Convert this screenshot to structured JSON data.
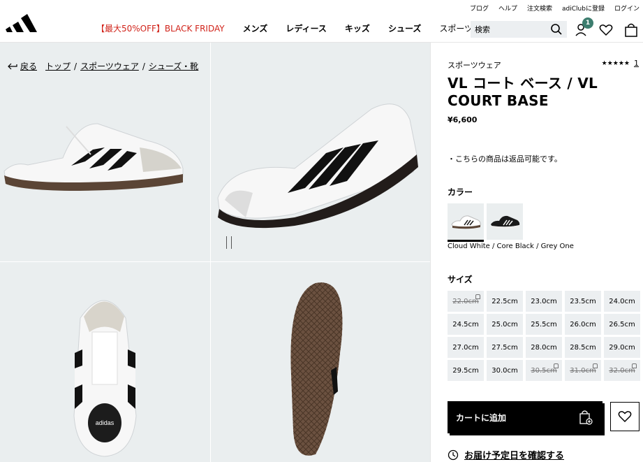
{
  "util_links": [
    "ブログ",
    "ヘルプ",
    "注文検索",
    "adiClubに登録",
    "ログイン"
  ],
  "nav": {
    "promo": "【最大50%OFF】BLACK FRIDAY",
    "items": [
      "メンズ",
      "レディース",
      "キッズ",
      "シューズ",
      "スポーツ"
    ]
  },
  "search": {
    "placeholder": "検索"
  },
  "cart_badge": "1",
  "breadcrumb": {
    "back": "戻る",
    "items": [
      "トップ",
      "スポーツウェア",
      "シューズ・靴"
    ]
  },
  "product": {
    "category": "スポーツウェア",
    "rating_stars": "★★★★★",
    "review_count": "1",
    "title": "VL コート ベース / VL COURT BASE",
    "price": "¥6,600",
    "return_notice": "・こちらの商品は返品可能です。",
    "color_label": "カラー",
    "color_name": "Cloud White / Core Black / Grey One",
    "size_label": "サイズ",
    "sizes": [
      {
        "label": "22.0cm",
        "available": false
      },
      {
        "label": "22.5cm",
        "available": true
      },
      {
        "label": "23.0cm",
        "available": true
      },
      {
        "label": "23.5cm",
        "available": true
      },
      {
        "label": "24.0cm",
        "available": true
      },
      {
        "label": "24.5cm",
        "available": true
      },
      {
        "label": "25.0cm",
        "available": true
      },
      {
        "label": "25.5cm",
        "available": true
      },
      {
        "label": "26.0cm",
        "available": true
      },
      {
        "label": "26.5cm",
        "available": true
      },
      {
        "label": "27.0cm",
        "available": true
      },
      {
        "label": "27.5cm",
        "available": true
      },
      {
        "label": "28.0cm",
        "available": true
      },
      {
        "label": "28.5cm",
        "available": true
      },
      {
        "label": "29.0cm",
        "available": true
      },
      {
        "label": "29.5cm",
        "available": true
      },
      {
        "label": "30.0cm",
        "available": true
      },
      {
        "label": "30.5cm",
        "available": false
      },
      {
        "label": "31.0cm",
        "available": false
      },
      {
        "label": "32.0cm",
        "available": false
      }
    ],
    "add_to_cart": "カートに追加",
    "delivery_check": "お届け予定日を確認する"
  },
  "colors": {
    "accent": "#3c7d6e",
    "promo": "#d1231a",
    "image_bg": "#eaeeef"
  }
}
